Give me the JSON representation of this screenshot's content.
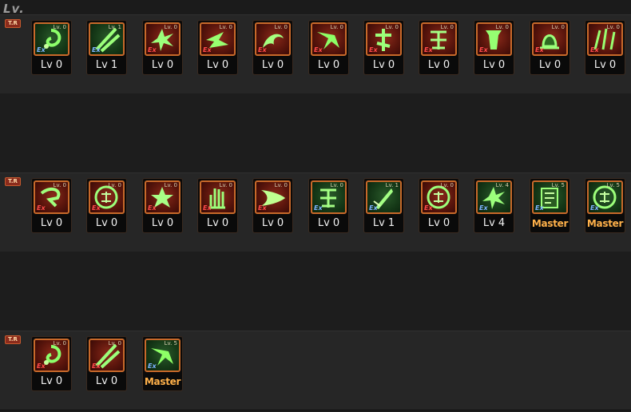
{
  "header": {
    "title": "Lv."
  },
  "tiers": [
    {
      "badge": "T.R",
      "skills": [
        {
          "level_text": "Lv 0",
          "mini": "Lv. 0",
          "tag": "Ex",
          "style": "green",
          "glyph": "swirl"
        },
        {
          "level_text": "Lv 1",
          "mini": "Lv. 1",
          "tag": "Ex",
          "style": "green",
          "glyph": "slash"
        },
        {
          "level_text": "Lv 0",
          "mini": "Lv. 0",
          "tag": "Ex",
          "style": "red",
          "glyph": "burst"
        },
        {
          "level_text": "Lv 0",
          "mini": "Lv. 0",
          "tag": "Ex",
          "style": "red",
          "glyph": "arrows"
        },
        {
          "level_text": "Lv 0",
          "mini": "Lv. 0",
          "tag": "Ex",
          "style": "red",
          "glyph": "dragon"
        },
        {
          "level_text": "Lv 0",
          "mini": "Lv. 0",
          "tag": "Ex",
          "style": "red",
          "glyph": "wing"
        },
        {
          "level_text": "Lv 0",
          "mini": "Lv. 0",
          "tag": "Ex",
          "style": "red",
          "glyph": "cross"
        },
        {
          "level_text": "Lv 0",
          "mini": "Lv. 0",
          "tag": "Ex",
          "style": "red",
          "glyph": "kanji"
        },
        {
          "level_text": "Lv 0",
          "mini": "Lv. 0",
          "tag": "Ex",
          "style": "red",
          "glyph": "pillar"
        },
        {
          "level_text": "Lv 0",
          "mini": "Lv. 0",
          "tag": "Ex",
          "style": "red",
          "glyph": "bell"
        },
        {
          "level_text": "Lv 0",
          "mini": "Lv. 0",
          "tag": "Ex",
          "style": "red",
          "glyph": "claw"
        }
      ]
    },
    {
      "badge": "T.R",
      "skills": [
        {
          "level_text": "Lv 0",
          "mini": "Lv. 0",
          "tag": "Ex",
          "style": "red",
          "glyph": "hook"
        },
        {
          "level_text": "Lv 0",
          "mini": "Lv. 0",
          "tag": "Ex",
          "style": "red",
          "glyph": "circlechar"
        },
        {
          "level_text": "Lv 0",
          "mini": "Lv. 0",
          "tag": "Ex",
          "style": "red",
          "glyph": "star"
        },
        {
          "level_text": "Lv 0",
          "mini": "Lv. 0",
          "tag": "Ex",
          "style": "red",
          "glyph": "hand"
        },
        {
          "level_text": "Lv 0",
          "mini": "Lv. 0",
          "tag": "Ex",
          "style": "red",
          "glyph": "beam"
        },
        {
          "level_text": "Lv 0",
          "mini": "Lv. 0",
          "tag": "Ex",
          "style": "green",
          "glyph": "kanji"
        },
        {
          "level_text": "Lv 1",
          "mini": "Lv. 1",
          "tag": "Ex",
          "style": "green",
          "glyph": "blade"
        },
        {
          "level_text": "Lv 0",
          "mini": "Lv. 0",
          "tag": "Ex",
          "style": "red",
          "glyph": "circlechar"
        },
        {
          "level_text": "Lv 4",
          "mini": "Lv. 4",
          "tag": "Ex",
          "style": "green",
          "glyph": "burst"
        },
        {
          "level_text": "Master",
          "mini": "Lv. 5",
          "tag": "Ex",
          "style": "green",
          "glyph": "scroll"
        },
        {
          "level_text": "Master",
          "mini": "Lv. 5",
          "tag": "Ex",
          "style": "green",
          "glyph": "circlechar"
        }
      ]
    },
    {
      "badge": "T.R",
      "skills": [
        {
          "level_text": "Lv 0",
          "mini": "Lv. 0",
          "tag": "Ex",
          "style": "red",
          "glyph": "swirl"
        },
        {
          "level_text": "Lv 0",
          "mini": "Lv. 0",
          "tag": "Ex",
          "style": "red",
          "glyph": "slash"
        },
        {
          "level_text": "Master",
          "mini": "Lv. 5",
          "tag": "Ex",
          "style": "green",
          "glyph": "wing"
        }
      ]
    }
  ],
  "colors": {
    "master": "#ffb14a",
    "icon_border": "#c8692a",
    "band": "#262626"
  }
}
